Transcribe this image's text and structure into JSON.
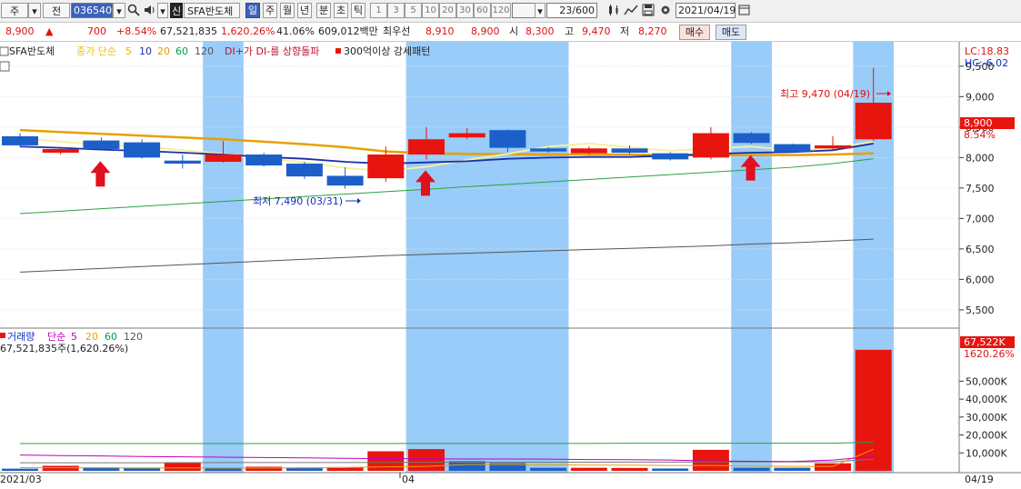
{
  "toolbar": {
    "dropdown1": "주",
    "dropdown2": "전",
    "stock_code": "036540",
    "badge": "신",
    "stock_name": "SFA반도체",
    "periods": [
      "일",
      "주",
      "월",
      "년",
      "분",
      "초",
      "틱"
    ],
    "active_period": "일",
    "intervals": [
      "1",
      "3",
      "5",
      "10",
      "20",
      "30",
      "60",
      "120"
    ],
    "count": "23",
    "count_total": "/600",
    "date": "2021/04/19"
  },
  "quote": {
    "price": "8,900",
    "arrow": "▲",
    "change": "700",
    "change_pct": "+8.54%",
    "volume": "67,521,835",
    "volume_pct": "1,620.26%",
    "turnover": "41.06%",
    "amount": "609,012백만",
    "best_label": "최우선",
    "best_ask": "8,910",
    "best_bid": "8,900",
    "open_label": "시",
    "open": "8,300",
    "high_label": "고",
    "high": "9,470",
    "low_label": "저",
    "low": "8,270",
    "buy_button": "매수",
    "sell_button": "매도"
  },
  "legend": {
    "stock_name": "SFA반도체",
    "ma_label": "종가 단순",
    "ma_periods": [
      "5",
      "10",
      "20",
      "60",
      "120"
    ],
    "ma_colors": [
      "#f0b000",
      "#1a2fa8",
      "#e8a000",
      "#00a040",
      "#555555"
    ],
    "signal1": "DI+가 DI-를 상향돌파",
    "signal2": "300억이상 강세패턴",
    "lc": "LC:18.83",
    "hc": "HC:-6.02"
  },
  "annotations": {
    "high": "최고 9,470 (04/19)",
    "low": "최저 7,490 (03/31)"
  },
  "volume_legend": {
    "title": "거래량",
    "ma_label": "단순",
    "ma_periods": [
      "5",
      "20",
      "60",
      "120"
    ],
    "value": "67,521,835주(1,620.26%)"
  },
  "right_labels": {
    "price_tag": "8,900",
    "price_pct": "8.54%",
    "vol_tag": "67,522K",
    "vol_pct": "1620.26%"
  },
  "x_labels": [
    "2021/03",
    "04",
    "04/19"
  ],
  "colors": {
    "up": "#e8150e",
    "down": "#1c5fc8",
    "highlight": "#99ccf8",
    "ma5": "#f5f0a0",
    "ma10": "#1a2fa8",
    "ma20": "#e8a000",
    "ma60": "#2aa040",
    "ma120": "#555555"
  },
  "chart_data": {
    "type": "candlestick",
    "ylim": [
      5200,
      9900
    ],
    "y_ticks": [
      5500,
      6000,
      6500,
      7000,
      7500,
      8000,
      8500,
      9000,
      9500
    ],
    "y_tick_labels": [
      "5,500",
      "6,000",
      "6,500",
      "7,000",
      "7,500",
      "8,000",
      "8,500",
      "9,000",
      "9,500"
    ],
    "candles": [
      {
        "o": 8350,
        "h": 8400,
        "l": 8180,
        "c": 8200
      },
      {
        "o": 8080,
        "h": 8160,
        "l": 8050,
        "c": 8140
      },
      {
        "o": 8280,
        "h": 8330,
        "l": 8120,
        "c": 8140
      },
      {
        "o": 8250,
        "h": 8300,
        "l": 7980,
        "c": 8000
      },
      {
        "o": 7950,
        "h": 8050,
        "l": 7820,
        "c": 7900
      },
      {
        "o": 7930,
        "h": 8270,
        "l": 7920,
        "c": 8050
      },
      {
        "o": 8050,
        "h": 8080,
        "l": 7850,
        "c": 7870
      },
      {
        "o": 7900,
        "h": 7930,
        "l": 7650,
        "c": 7690
      },
      {
        "o": 7700,
        "h": 7840,
        "l": 7490,
        "c": 7540
      },
      {
        "o": 7660,
        "h": 8180,
        "l": 7600,
        "c": 8050
      },
      {
        "o": 8050,
        "h": 8500,
        "l": 7970,
        "c": 8300
      },
      {
        "o": 8330,
        "h": 8480,
        "l": 8300,
        "c": 8400
      },
      {
        "o": 8450,
        "h": 8460,
        "l": 8090,
        "c": 8160
      },
      {
        "o": 8150,
        "h": 8170,
        "l": 8080,
        "c": 8100
      },
      {
        "o": 8070,
        "h": 8180,
        "l": 8050,
        "c": 8150
      },
      {
        "o": 8150,
        "h": 8200,
        "l": 8050,
        "c": 8080
      },
      {
        "o": 8070,
        "h": 8090,
        "l": 7950,
        "c": 7970
      },
      {
        "o": 8000,
        "h": 8500,
        "l": 7970,
        "c": 8400
      },
      {
        "o": 8400,
        "h": 8420,
        "l": 8220,
        "c": 8240
      },
      {
        "o": 8220,
        "h": 8230,
        "l": 8080,
        "c": 8090
      },
      {
        "o": 8150,
        "h": 8350,
        "l": 8130,
        "c": 8200
      },
      {
        "o": 8300,
        "h": 9470,
        "l": 8270,
        "c": 8900
      }
    ],
    "ma5": [
      8320,
      8260,
      8210,
      8180,
      8120,
      8060,
      8000,
      7920,
      7830,
      7780,
      7850,
      7960,
      8060,
      8180,
      8230,
      8170,
      8110,
      8150,
      8180,
      8120,
      8150,
      8260
    ],
    "ma10": [
      8180,
      8160,
      8130,
      8110,
      8080,
      8050,
      8010,
      7980,
      7930,
      7900,
      7920,
      7940,
      7980,
      8000,
      8010,
      8010,
      8030,
      8060,
      8080,
      8090,
      8120,
      8230
    ],
    "ma20": [
      8450,
      8420,
      8390,
      8360,
      8330,
      8300,
      8260,
      8220,
      8170,
      8100,
      8070,
      8060,
      8060,
      8050,
      8050,
      8050,
      8040,
      8040,
      8040,
      8040,
      8050,
      8070
    ],
    "ma60": [
      7080,
      7120,
      7160,
      7200,
      7240,
      7280,
      7320,
      7360,
      7400,
      7440,
      7480,
      7520,
      7560,
      7600,
      7640,
      7680,
      7720,
      7760,
      7800,
      7840,
      7900,
      7980
    ],
    "ma120": [
      6120,
      6150,
      6180,
      6210,
      6240,
      6270,
      6300,
      6330,
      6360,
      6390,
      6410,
      6430,
      6450,
      6470,
      6490,
      6510,
      6530,
      6550,
      6580,
      6600,
      6630,
      6660
    ],
    "highlight_ranges": [
      [
        5,
        5
      ],
      [
        10,
        13
      ],
      [
        18,
        18
      ],
      [
        21,
        21
      ]
    ],
    "signal_arrows": [
      2,
      10,
      18
    ],
    "volume": {
      "y_ticks": [
        10000,
        20000,
        30000,
        40000,
        50000
      ],
      "y_tick_labels": [
        "10,000K",
        "20,000K",
        "30,000K",
        "40,000K",
        "50,000K"
      ],
      "ylim": [
        0,
        72000
      ],
      "values": [
        1200,
        2800,
        1900,
        1500,
        4800,
        1800,
        2300,
        1500,
        2100,
        10900,
        12100,
        5400,
        4300,
        1700,
        1700,
        1600,
        1300,
        11700,
        1700,
        1700,
        4200,
        67522
      ],
      "up_down": [
        "d",
        "u",
        "d",
        "d",
        "u",
        "d",
        "u",
        "d",
        "u",
        "u",
        "u",
        "d",
        "d",
        "d",
        "u",
        "u",
        "d",
        "u",
        "d",
        "d",
        "u",
        "u"
      ],
      "ma5": [
        8800,
        8500,
        8300,
        8000,
        7800,
        7600,
        7400,
        7200,
        7000,
        6800,
        6700,
        6600,
        6600,
        6500,
        6300,
        6200,
        6000,
        5500,
        5300,
        5200,
        6000,
        8000
      ],
      "ma20": [
        1800,
        1700,
        1700,
        1600,
        1600,
        1600,
        1600,
        1700,
        1800,
        2200,
        2500,
        3500,
        3500,
        3400,
        3200,
        3200,
        3000,
        3000,
        2700,
        2500,
        2500,
        12000
      ],
      "ma60": [
        4500,
        4500,
        4500,
        4500,
        4500,
        4600,
        4600,
        4600,
        4600,
        4700,
        4800,
        4800,
        4800,
        4800,
        4800,
        4900,
        4900,
        5000,
        5000,
        5000,
        5000,
        6500
      ],
      "ma120": [
        15200,
        15200,
        15200,
        15200,
        15200,
        15200,
        15200,
        15200,
        15200,
        15200,
        15300,
        15300,
        15300,
        15300,
        15300,
        15400,
        15400,
        15400,
        15400,
        15400,
        15400,
        16000
      ]
    }
  }
}
